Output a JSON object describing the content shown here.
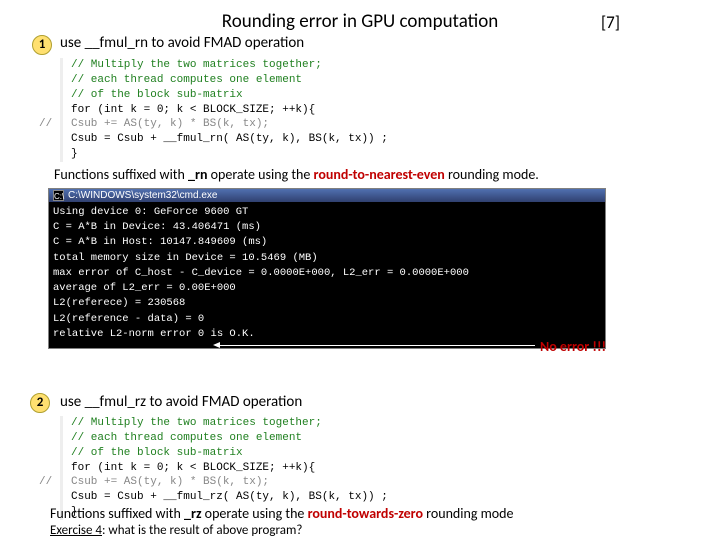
{
  "title": "Rounding error in GPU computation",
  "page_ref": "[7]",
  "section1": {
    "num": "1",
    "heading": "use __fmul_rn to avoid FMAD operation",
    "code": {
      "c1": "// Multiply the two matrices together;",
      "c2": "// each thread computes one element",
      "c3": "// of the block sub-matrix",
      "l1": "for (int k = 0; k < BLOCK_SIZE; ++k){",
      "l2a": "    Csub += AS(ty, k) * BS(k, tx);",
      "slashes": "//",
      "l3": "    Csub = Csub + __fmul_rn( AS(ty, k), BS(k, tx)) ;",
      "l4": "}"
    },
    "caption_pre": "Functions suffixed with ",
    "caption_suffix": "_rn",
    "caption_mid": " operate using the ",
    "caption_mode": "round-to-nearest-even",
    "caption_post": " rounding mode."
  },
  "terminal": {
    "title": "C:\\WINDOWS\\system32\\cmd.exe",
    "lines": [
      "Using device 0: GeForce 9600 GT",
      "C = A*B in Device: 43.406471 (ms)",
      "C = A*B in Host: 10147.849609 (ms)",
      "total memory size in Device = 10.5469 (MB)",
      "max error of C_host - C_device = 0.0000E+000, L2_err = 0.0000E+000",
      "average of L2_err = 0.00E+000",
      "L2(referece) = 230568",
      "L2(reference - data) = 0",
      "relative L2-norm error 0 is O.K."
    ]
  },
  "noerror": "No error !!!",
  "section2": {
    "num": "2",
    "heading": "use __fmul_rz to avoid FMAD operation",
    "code": {
      "c1": "// Multiply the two matrices together;",
      "c2": "// each thread computes one element",
      "c3": "// of the block sub-matrix",
      "l1": "for (int k = 0; k < BLOCK_SIZE; ++k){",
      "l2a": "    Csub += AS(ty, k) * BS(k, tx);",
      "slashes": "//",
      "l3": "    Csub = Csub + __fmul_rz( AS(ty, k), BS(k, tx)) ;",
      "l4": "}"
    },
    "caption_pre": "Functions suffixed with ",
    "caption_suffix": "_rz",
    "caption_mid": " operate using the ",
    "caption_mode": "round-towards-zero",
    "caption_post": " rounding mode"
  },
  "exercise_label": "Exercise 4",
  "exercise_text": ": what is the result of above program?"
}
